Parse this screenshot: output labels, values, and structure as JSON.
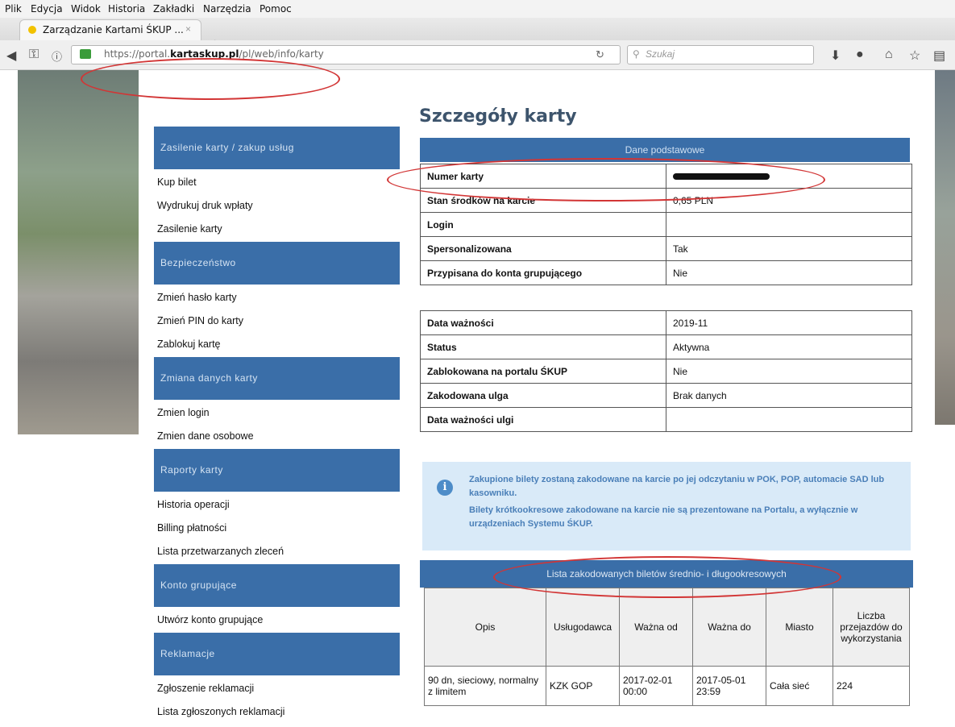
{
  "browser": {
    "menu": [
      "Plik",
      "Edycja",
      "Widok",
      "Historia",
      "Zakładki",
      "Narzędzia",
      "Pomoc"
    ],
    "tab_title": "Zarządzanie Kartami ŚKUP ...",
    "tab_close": "×",
    "new_tab": "+",
    "url_prefix": "https://portal.",
    "url_domain": "kartaskup.pl",
    "url_path": "/pl/web/info/karty",
    "search_placeholder": "Szukaj"
  },
  "sidebar": [
    {
      "header": "Zasilenie karty / zakup usług",
      "items": [
        "Kup bilet",
        "Wydrukuj druk wpłaty",
        "Zasilenie karty"
      ]
    },
    {
      "header": "Bezpieczeństwo",
      "items": [
        "Zmień hasło karty",
        "Zmień PIN do karty",
        "Zablokuj kartę"
      ]
    },
    {
      "header": "Zmiana danych karty",
      "items": [
        "Zmien login",
        "Zmien dane osobowe"
      ]
    },
    {
      "header": "Raporty karty",
      "items": [
        "Historia operacji",
        "Billing płatności",
        "Lista przetwarzanych zleceń"
      ]
    },
    {
      "header": "Konto grupujące",
      "items": [
        "Utwórz konto grupujące"
      ]
    },
    {
      "header": "Reklamacje",
      "items": [
        "Zgłoszenie reklamacji",
        "Lista zgłoszonych reklamacji"
      ]
    }
  ],
  "main": {
    "title": "Szczegóły karty",
    "section_header": "Dane podstawowe",
    "basic_rows": [
      {
        "label": "Numer karty",
        "value": ""
      },
      {
        "label": "Stan środków na karcie",
        "value": "0,65 PLN"
      },
      {
        "label": "Login",
        "value": ""
      },
      {
        "label": "Spersonalizowana",
        "value": "Tak"
      },
      {
        "label": "Przypisana do konta grupującego",
        "value": "Nie"
      }
    ],
    "status_rows": [
      {
        "label": "Data ważności",
        "value": "2019-11"
      },
      {
        "label": "Status",
        "value": "Aktywna"
      },
      {
        "label": "Zablokowana na portalu ŚKUP",
        "value": "Nie"
      },
      {
        "label": "Zakodowana ulga",
        "value": "Brak danych"
      },
      {
        "label": "Data ważności ulgi",
        "value": ""
      }
    ],
    "info": {
      "line1": "Zakupione bilety zostaną zakodowane na karcie po jej odczytaniu w POK, POP, automacie SAD lub kasowniku.",
      "line2": "Bilety krótkookresowe zakodowane na karcie nie są prezentowane na Portalu, a wyłącznie w urządzeniach Systemu ŚKUP."
    },
    "tickets": {
      "header": "Lista zakodowanych biletów średnio- i długookresowych",
      "columns": [
        "Opis",
        "Usługodawca",
        "Ważna od",
        "Ważna do",
        "Miasto",
        "Liczba przejazdów do wykorzystania"
      ],
      "rows": [
        [
          "90 dn, sieciowy, normalny z limitem",
          "KZK GOP",
          "2017-02-01 00:00",
          "2017-05-01 23:59",
          "Cała sieć",
          "224"
        ]
      ]
    }
  }
}
